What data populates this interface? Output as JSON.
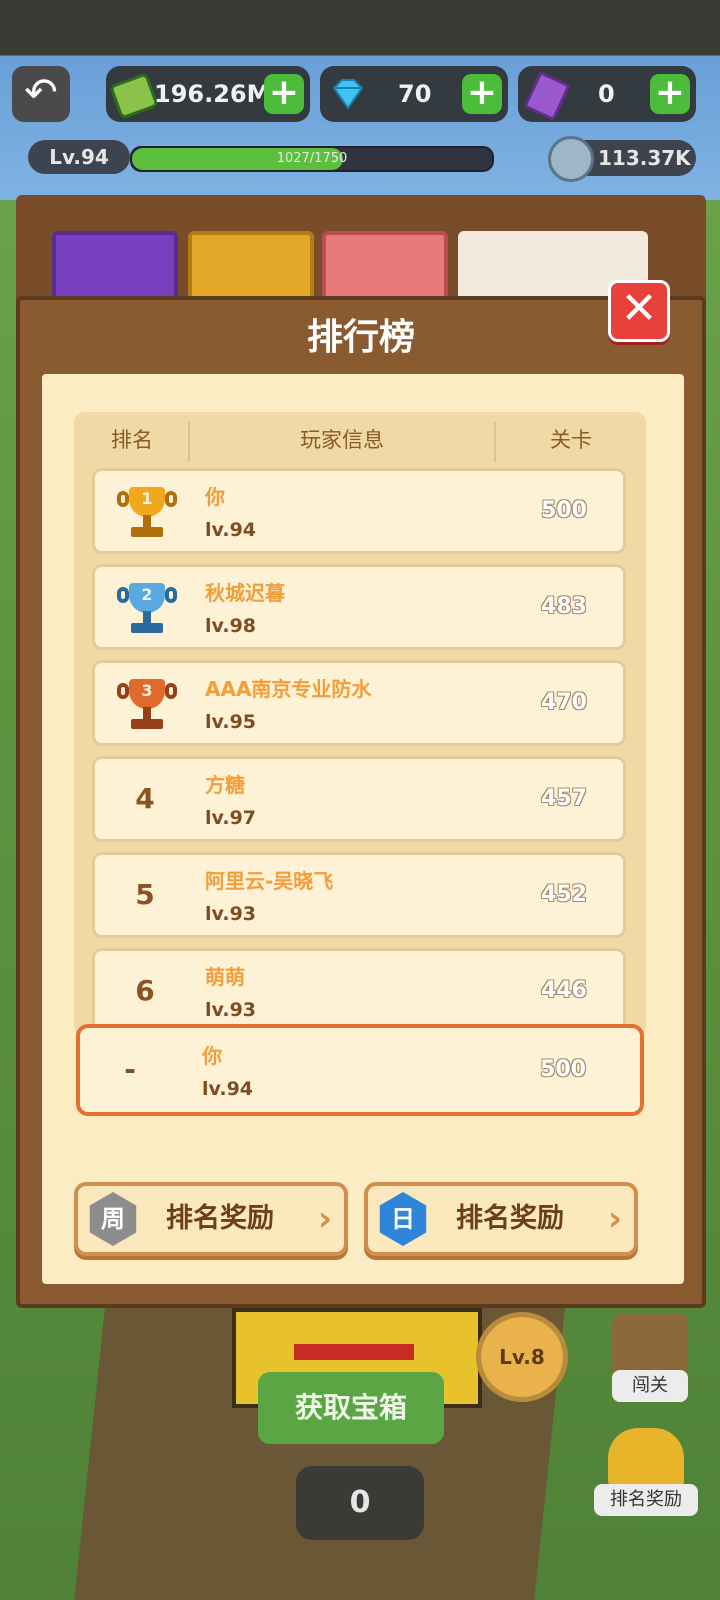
{
  "topbar": {
    "cash": "196.26M",
    "gems": "70",
    "tickets": "0",
    "level": "Lv.94",
    "xp_text": "1027/1750",
    "xp_progress": 0.587,
    "coins": "113.37K",
    "icons": {
      "back": "back-arrow-icon",
      "cash": "cash-icon",
      "gem": "diamond-icon",
      "ticket": "ticket-icon",
      "plus": "plus-icon",
      "coin": "coin-icon"
    }
  },
  "leaderboard": {
    "title": "排行榜",
    "columns": [
      "排名",
      "玩家信息",
      "关卡"
    ],
    "rows": [
      {
        "rank": "",
        "trophy": "gold",
        "trophy_num": "1",
        "name": "你",
        "level": "lv.94",
        "score": "500"
      },
      {
        "rank": "",
        "trophy": "silver",
        "trophy_num": "2",
        "name": "秋城迟暮",
        "level": "lv.98",
        "score": "483"
      },
      {
        "rank": "",
        "trophy": "bronze",
        "trophy_num": "3",
        "name": "AAA南京专业防水",
        "level": "lv.95",
        "score": "470"
      },
      {
        "rank": "4",
        "trophy": "",
        "trophy_num": "",
        "name": "方糖",
        "level": "lv.97",
        "score": "457"
      },
      {
        "rank": "5",
        "trophy": "",
        "trophy_num": "",
        "name": "阿里云-吴晓飞",
        "level": "lv.93",
        "score": "452"
      },
      {
        "rank": "6",
        "trophy": "",
        "trophy_num": "",
        "name": "萌萌",
        "level": "lv.93",
        "score": "446"
      }
    ],
    "self": {
      "rank": "-",
      "name": "你",
      "level": "lv.94",
      "score": "500"
    },
    "weekly_badge": "周",
    "daily_badge": "日",
    "reward_label": "排名奖励",
    "close_icon": "close-icon"
  },
  "bottom": {
    "level_badge": "Lv.8",
    "chest_button": "获取宝箱",
    "chest_count": "0",
    "side_level": "闯关",
    "side_reward": "排名奖励"
  },
  "colors": {
    "gold": "#f2a81d",
    "silver": "#5aa8e0",
    "bronze": "#e06a2c",
    "accent": "#e3702e"
  }
}
